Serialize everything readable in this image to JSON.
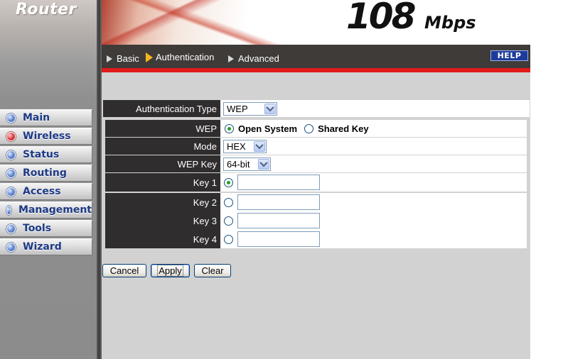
{
  "sidebar": {
    "brand": "Router",
    "items": [
      {
        "label": "Main",
        "dot": "blue"
      },
      {
        "label": "Wireless",
        "dot": "red"
      },
      {
        "label": "Status",
        "dot": "blue"
      },
      {
        "label": "Routing",
        "dot": "blue"
      },
      {
        "label": "Access",
        "dot": "blue"
      },
      {
        "label": "Management",
        "dot": "blue"
      },
      {
        "label": "Tools",
        "dot": "blue"
      },
      {
        "label": "Wizard",
        "dot": "blue"
      }
    ]
  },
  "header": {
    "logo_number": "108",
    "logo_unit": "Mbps"
  },
  "tabs": [
    {
      "label": "Basic",
      "active": false
    },
    {
      "label": "Authentication",
      "active": true
    },
    {
      "label": "Advanced",
      "active": false
    }
  ],
  "help_label": "HELP",
  "form": {
    "auth_type": {
      "label": "Authentication Type",
      "value": "WEP"
    },
    "wep": {
      "label": "WEP",
      "options": [
        "Open System",
        "Shared Key"
      ],
      "selected": "Open System"
    },
    "mode": {
      "label": "Mode",
      "value": "HEX"
    },
    "wep_key": {
      "label": "WEP Key",
      "value": "64-bit"
    },
    "keys": [
      {
        "label": "Key 1",
        "selected": true,
        "value": ""
      },
      {
        "label": "Key 2",
        "selected": false,
        "value": ""
      },
      {
        "label": "Key 3",
        "selected": false,
        "value": ""
      },
      {
        "label": "Key 4",
        "selected": false,
        "value": ""
      }
    ]
  },
  "buttons": {
    "cancel": "Cancel",
    "apply": "Apply",
    "clear": "Clear"
  },
  "colors": {
    "accent_red": "#e01b1b",
    "tab_bar": "#3f3b39",
    "menu_text": "#1d3a86",
    "active_tab_arrow": "#f3b51f",
    "help_button": "#1d3b9a"
  }
}
